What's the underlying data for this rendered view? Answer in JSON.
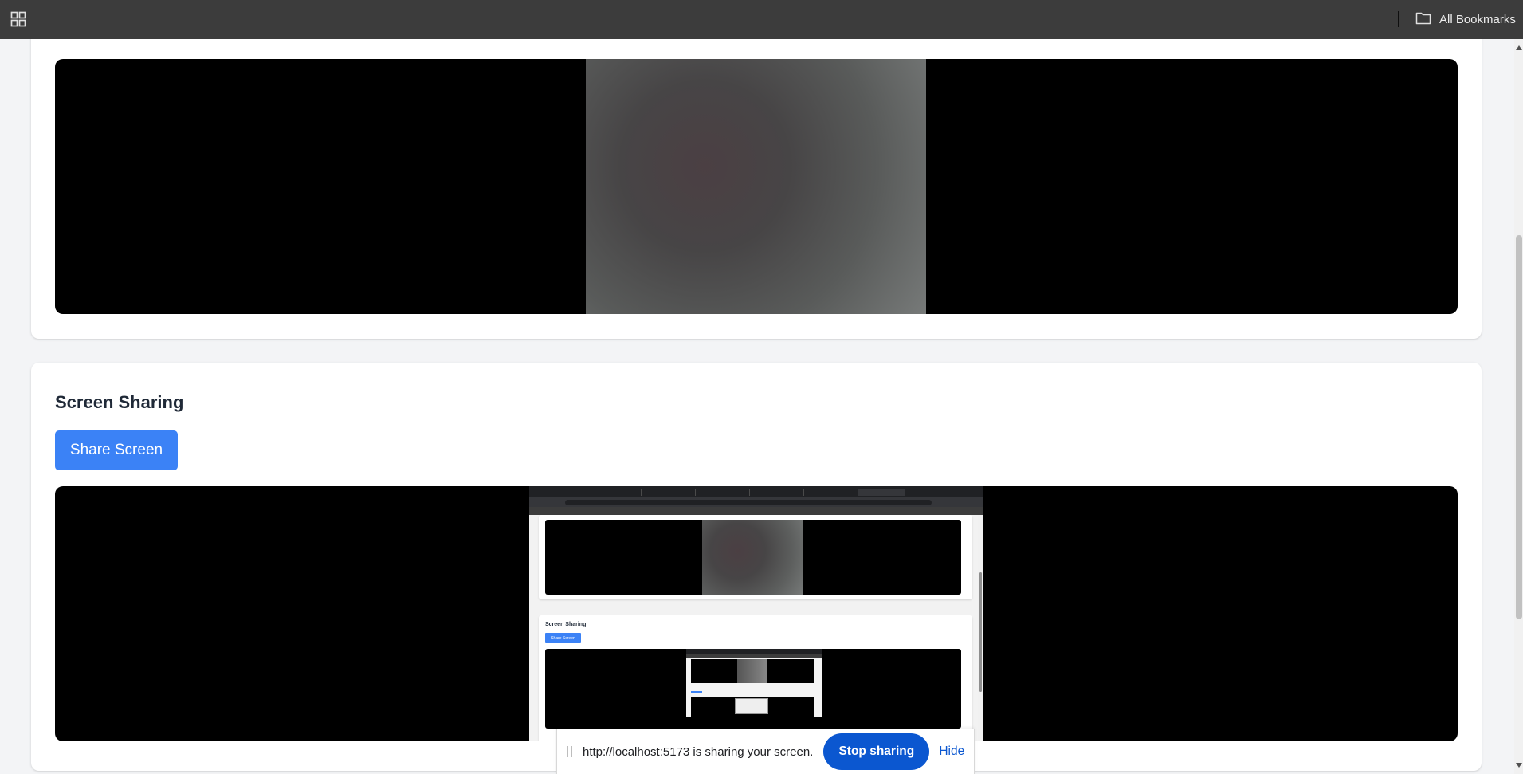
{
  "browser": {
    "apps_icon": "apps-grid-icon",
    "bookmarks_label": "All Bookmarks",
    "folder_icon": "folder-icon"
  },
  "camera_section": {
    "video": "camera-video"
  },
  "screen_sharing": {
    "title": "Screen Sharing",
    "share_button_label": "Share Screen"
  },
  "mirror": {
    "title": "Screen Sharing",
    "button_label": "Share Screen"
  },
  "sharing_notice": {
    "message": "http://localhost:5173 is sharing your screen.",
    "stop_label": "Stop sharing",
    "hide_label": "Hide"
  },
  "colors": {
    "primary": "#3b82f6",
    "chrome_blue": "#0b57d0",
    "toolbar": "#3c3c3c",
    "page_bg": "#f3f4f6"
  }
}
